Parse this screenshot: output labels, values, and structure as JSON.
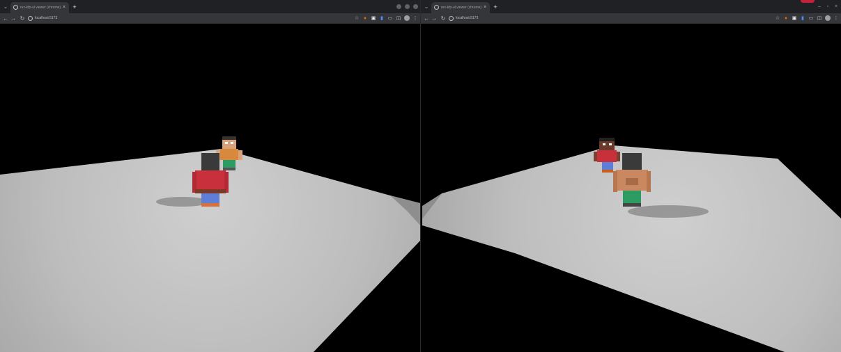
{
  "browser_left": {
    "tab_title": "rex-kfp-ul viewer (chrome)",
    "url": "localhost:5173"
  },
  "browser_right": {
    "tab_title": "rex-kfp-ul viewer (chrome)",
    "url": "localhost:5173"
  },
  "icons": {
    "tab_search": "chevron-down-icon",
    "new_tab": "plus-icon",
    "back": "arrow-left-icon",
    "forward": "arrow-right-icon",
    "reload": "reload-icon",
    "bookmark": "star-icon",
    "menu": "kebab-menu-icon"
  },
  "colors": {
    "tabstrip": "#202124",
    "toolbar": "#35363a",
    "scene_background": "#000000",
    "floor": "#c8c8c8",
    "red_shirt": "#c8303c",
    "record_badge": "#c5213a"
  }
}
